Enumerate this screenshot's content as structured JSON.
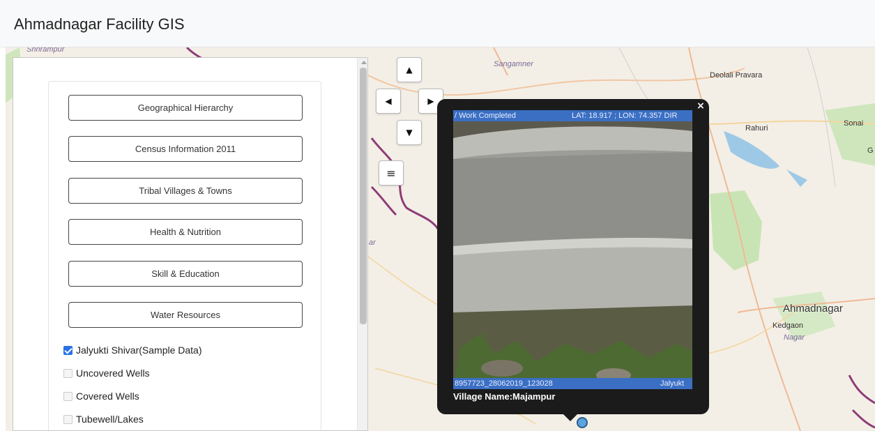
{
  "app": {
    "title": "Ahmadnagar Facility GIS"
  },
  "map": {
    "labels": {
      "shrirampur": "Shrirampur",
      "sangamner": "Sangamner",
      "deolali": "Deolali Pravara",
      "rahuri": "Rahuri",
      "sonai": "Sonai",
      "g": "G",
      "ahmadnagar": "Ahmadnagar",
      "kedgaon": "Kedgaon",
      "nagar": "Nagar",
      "ar": "ar"
    },
    "controls": {
      "pan_up": "▲",
      "pan_left": "◀",
      "pan_right": "▶",
      "pan_down": "▼",
      "layers": "≡"
    }
  },
  "panel": {
    "categories": [
      "Geographical Hierarchy",
      "Census Information 2011",
      "Tribal Villages & Towns",
      "Health & Nutrition",
      "Skill & Education",
      "Water Resources"
    ],
    "layers": [
      {
        "label": "Jalyukti Shivar(Sample Data)",
        "checked": true
      },
      {
        "label": "Uncovered Wells",
        "checked": false
      },
      {
        "label": "Covered Wells",
        "checked": false
      },
      {
        "label": "Tubewell/Lakes",
        "checked": false
      }
    ]
  },
  "popup": {
    "close": "×",
    "stamp_top_left": "/ Work Completed",
    "stamp_top_right": "LAT: 18.917 ; LON: 74.357  DIR",
    "stamp_bottom_left": "8957723_28062019_123028",
    "stamp_bottom_right": "Jalyukt",
    "village": "Village Name:Majampur"
  },
  "colors": {
    "accent": "#2a72e8",
    "stamp": "#3a6fc4",
    "popup_bg": "#1b1b1b",
    "marker": "#5ba4e0"
  }
}
